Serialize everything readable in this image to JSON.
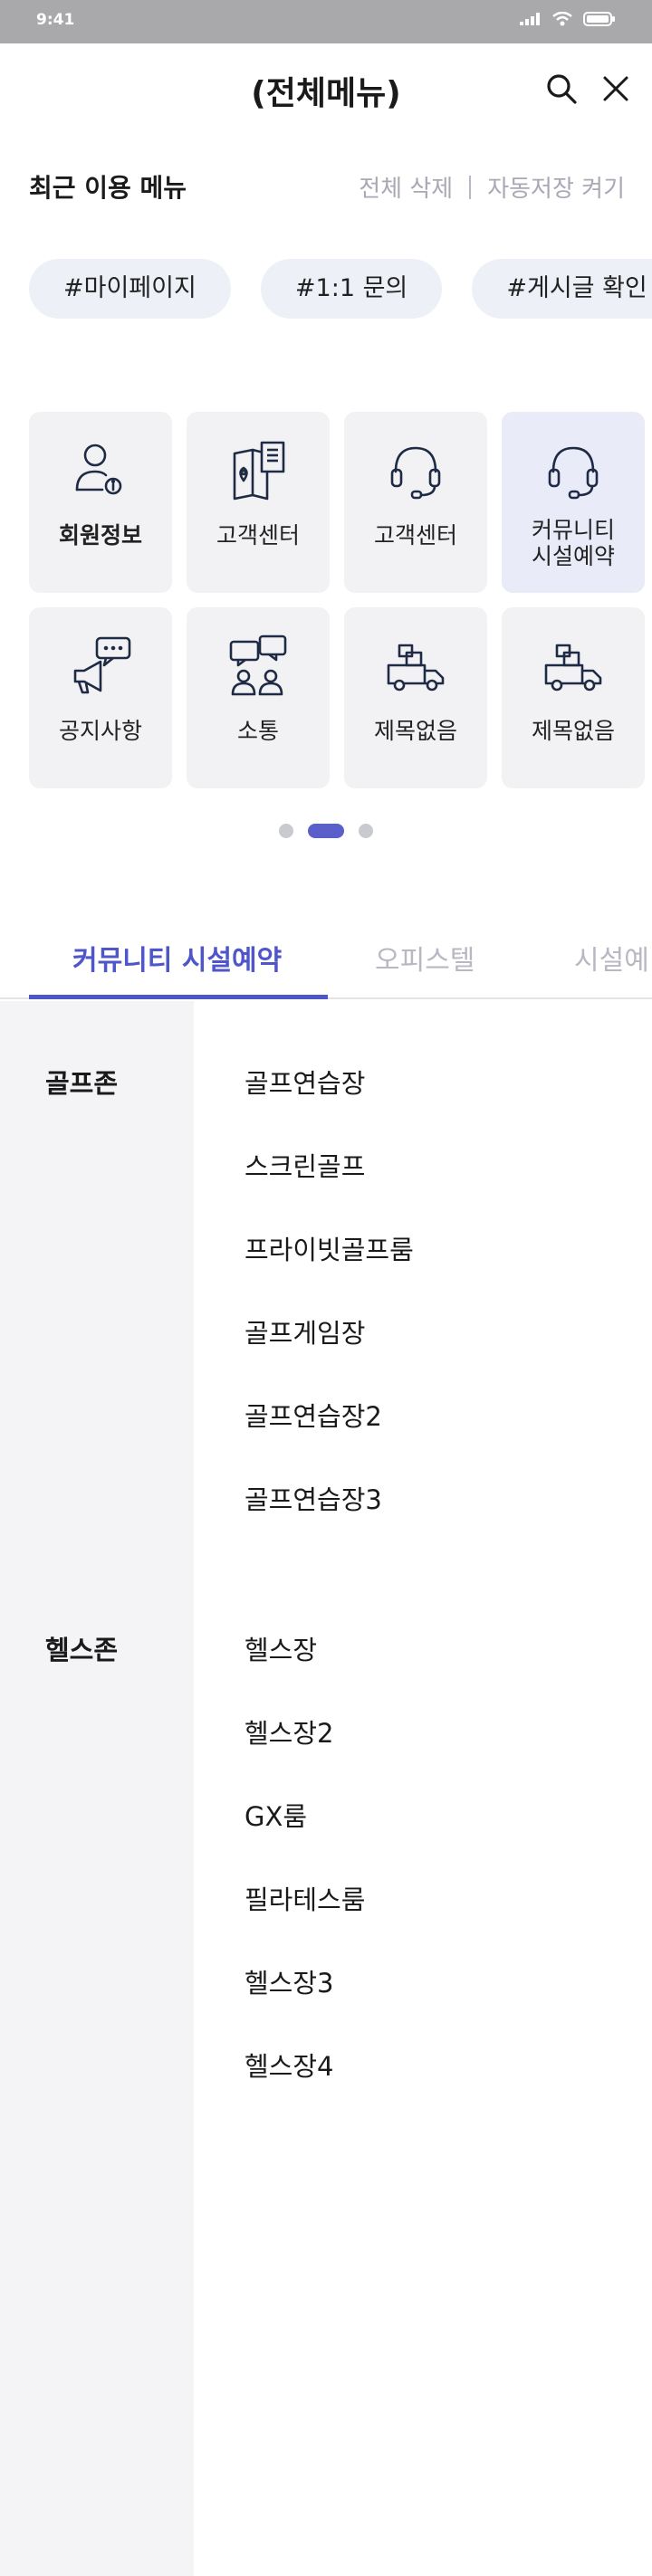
{
  "status_bar": {
    "time": "9:41"
  },
  "header": {
    "title": "(전체메뉴)"
  },
  "recent": {
    "title": "최근 이용 메뉴",
    "delete_all": "전체 삭제",
    "autosave": "자동저장 켜기",
    "chips": [
      "#마이페이지",
      "#1:1 문의",
      "#게시글 확인"
    ]
  },
  "menu_grid": [
    {
      "label": "회원정보",
      "icon": "user-info-icon"
    },
    {
      "label": "고객센터",
      "icon": "map-document-icon"
    },
    {
      "label": "고객센터",
      "icon": "headset-icon"
    },
    {
      "label": "커뮤니티\n시설예약",
      "icon": "headset-icon"
    },
    {
      "label": "공지사항",
      "icon": "megaphone-icon"
    },
    {
      "label": "소통",
      "icon": "chat-people-icon"
    },
    {
      "label": "제목없음",
      "icon": "truck-icon"
    },
    {
      "label": "제목없음",
      "icon": "truck-icon"
    }
  ],
  "pagination": {
    "pages": 3,
    "current": 2
  },
  "tabs": [
    "커뮤니티 시설예약",
    "오피스텔",
    "시설예"
  ],
  "sections": [
    {
      "title": "골프존",
      "items": [
        "골프연습장",
        "스크린골프",
        "프라이빗골프룸",
        "골프게임장",
        "골프연습장2",
        "골프연습장3"
      ]
    },
    {
      "title": "헬스존",
      "items": [
        "헬스장",
        "헬스장2",
        "GX룸",
        "필라테스룸",
        "헬스장3",
        "헬스장4"
      ]
    }
  ],
  "colors": {
    "accent": "#4f56c9",
    "tile_bg": "#f2f2f4",
    "tile_active_bg": "#e9ebf9",
    "sidebar_bg": "#f4f4f6"
  }
}
